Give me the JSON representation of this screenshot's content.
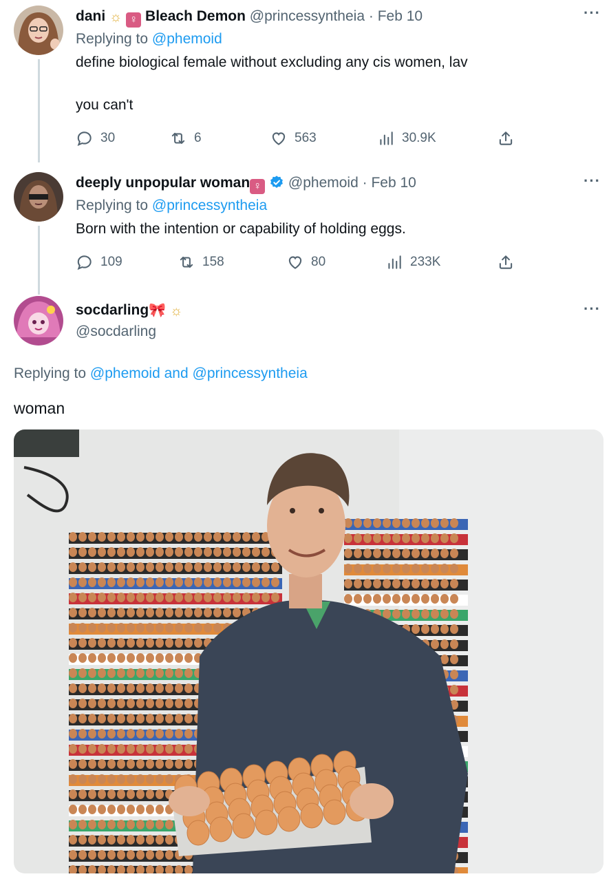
{
  "tweets": [
    {
      "display_name": "dani",
      "display_name_extra": "Bleach Demon",
      "badges": [
        "sun-icon",
        "female-symbol-badge"
      ],
      "handle": "@princessyntheia",
      "separator": "·",
      "date": "Feb 10",
      "replying_prefix": "Replying to",
      "replying_to": "@phemoid",
      "text_lines": [
        "define biological female without excluding any cis women, lav",
        "you can't"
      ],
      "metrics": {
        "replies": "30",
        "reposts": "6",
        "likes": "563",
        "views": "30.9K"
      }
    },
    {
      "display_name": "deeply unpopular woman",
      "badges": [
        "female-symbol-badge",
        "verified-badge-icon"
      ],
      "handle": "@phemoid",
      "separator": "·",
      "date": "Feb 10",
      "replying_prefix": "Replying to",
      "replying_to": "@princessyntheia",
      "text_lines": [
        "Born with the intention or capability of holding eggs."
      ],
      "metrics": {
        "replies": "109",
        "reposts": "158",
        "likes": "80",
        "views": "233K"
      }
    },
    {
      "display_name": "socdarling",
      "badges": [
        "bow-icon",
        "sun-icon"
      ],
      "handle": "@socdarling",
      "replying_prefix": "Replying to",
      "replying_to": "@phemoid",
      "replying_conj": "and",
      "replying_to_2": "@princessyntheia",
      "text_lines": [
        "woman"
      ]
    }
  ],
  "more_glyph": "···",
  "badge_glyphs": {
    "sun": "☼",
    "female": "♀",
    "bow": "🎀"
  },
  "colors": {
    "text": "#0f1419",
    "muted": "#536471",
    "link": "#1d9bf0",
    "female_badge": "#d95b83",
    "thread_line": "#cfd9de"
  }
}
